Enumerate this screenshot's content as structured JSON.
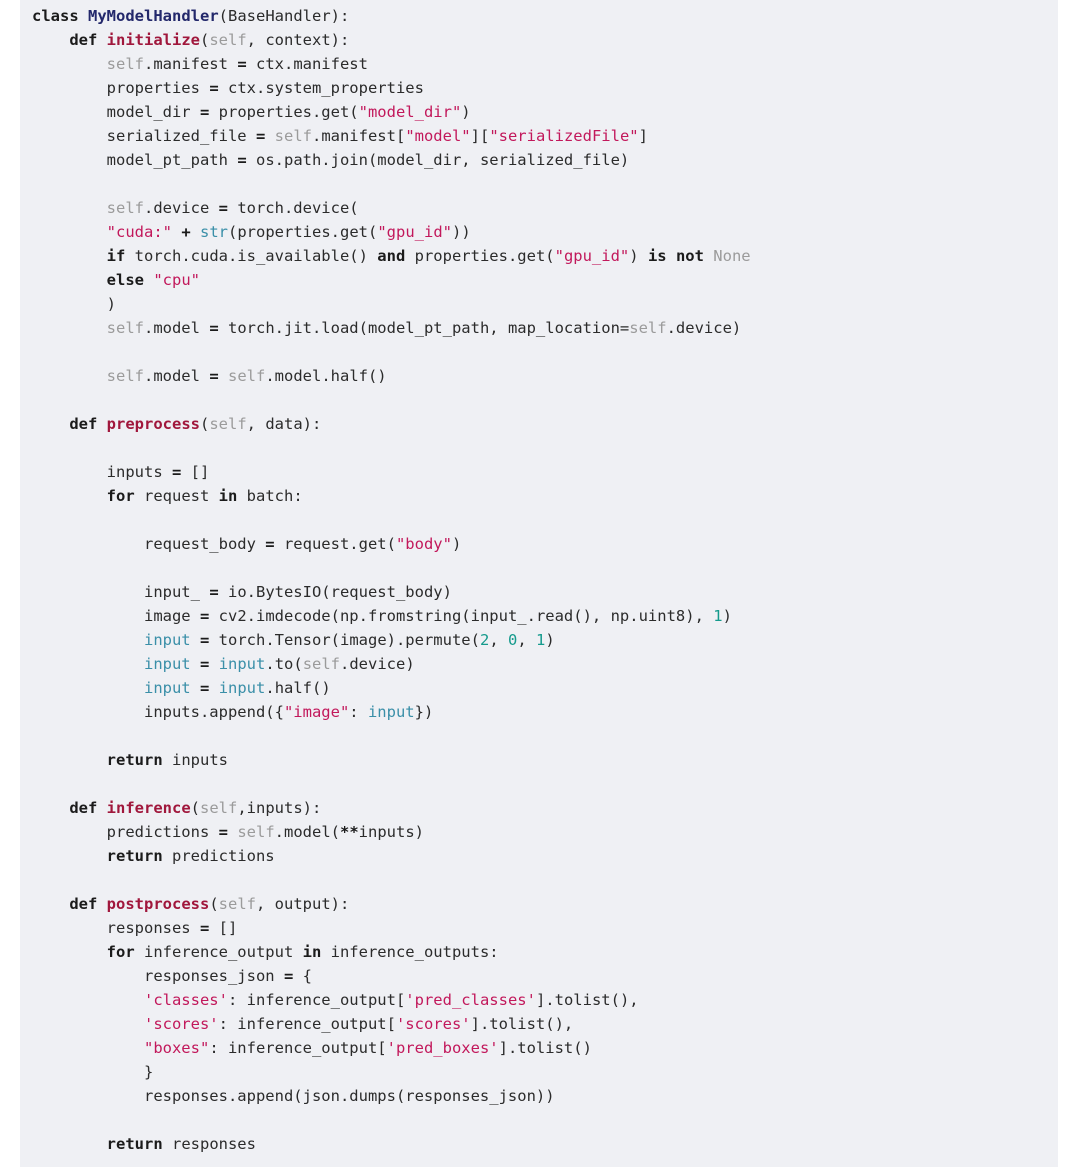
{
  "document": {
    "kind": "code-snippet",
    "language": "python",
    "background_color": "#eff0f4",
    "page_background_color": "#ffffff"
  },
  "theme": {
    "plain": "#2b2b2b",
    "keyword": "#1b1b1b",
    "class_name": "#23286b",
    "function_name": "#a0173c",
    "string": "#c2185b",
    "number": "#149a8c",
    "builtin": "#3a8fa8",
    "self": "#9b9b9b",
    "none": "#9b9b9b"
  },
  "code": {
    "lines": [
      [
        {
          "t": "kw",
          "v": "class"
        },
        {
          "t": "plain",
          "v": " "
        },
        {
          "t": "class",
          "v": "MyModelHandler"
        },
        {
          "t": "plain",
          "v": "(BaseHandler):"
        }
      ],
      [
        {
          "t": "plain",
          "v": "    "
        },
        {
          "t": "def",
          "v": "def"
        },
        {
          "t": "plain",
          "v": " "
        },
        {
          "t": "func",
          "v": "initialize"
        },
        {
          "t": "plain",
          "v": "("
        },
        {
          "t": "self",
          "v": "self"
        },
        {
          "t": "plain",
          "v": ", context):"
        }
      ],
      [
        {
          "t": "plain",
          "v": "        "
        },
        {
          "t": "self",
          "v": "self"
        },
        {
          "t": "plain",
          "v": ".manifest "
        },
        {
          "t": "op-b",
          "v": "="
        },
        {
          "t": "plain",
          "v": " ctx.manifest"
        }
      ],
      [
        {
          "t": "plain",
          "v": "        properties "
        },
        {
          "t": "op-b",
          "v": "="
        },
        {
          "t": "plain",
          "v": " ctx.system_properties"
        }
      ],
      [
        {
          "t": "plain",
          "v": "        model_dir "
        },
        {
          "t": "op-b",
          "v": "="
        },
        {
          "t": "plain",
          "v": " properties.get("
        },
        {
          "t": "str",
          "v": "\"model_dir\""
        },
        {
          "t": "plain",
          "v": ")"
        }
      ],
      [
        {
          "t": "plain",
          "v": "        serialized_file "
        },
        {
          "t": "op-b",
          "v": "="
        },
        {
          "t": "plain",
          "v": " "
        },
        {
          "t": "self",
          "v": "self"
        },
        {
          "t": "plain",
          "v": ".manifest["
        },
        {
          "t": "str",
          "v": "\"model\""
        },
        {
          "t": "plain",
          "v": "]["
        },
        {
          "t": "str",
          "v": "\"serializedFile\""
        },
        {
          "t": "plain",
          "v": "]"
        }
      ],
      [
        {
          "t": "plain",
          "v": "        model_pt_path "
        },
        {
          "t": "op-b",
          "v": "="
        },
        {
          "t": "plain",
          "v": " os.path.join(model_dir, serialized_file)"
        }
      ],
      [],
      [
        {
          "t": "plain",
          "v": "        "
        },
        {
          "t": "self",
          "v": "self"
        },
        {
          "t": "plain",
          "v": ".device "
        },
        {
          "t": "op-b",
          "v": "="
        },
        {
          "t": "plain",
          "v": " torch.device("
        }
      ],
      [
        {
          "t": "plain",
          "v": "        "
        },
        {
          "t": "str",
          "v": "\"cuda:\""
        },
        {
          "t": "plain",
          "v": " "
        },
        {
          "t": "op-b",
          "v": "+"
        },
        {
          "t": "plain",
          "v": " "
        },
        {
          "t": "builtin",
          "v": "str"
        },
        {
          "t": "plain",
          "v": "(properties.get("
        },
        {
          "t": "str",
          "v": "\"gpu_id\""
        },
        {
          "t": "plain",
          "v": "))"
        }
      ],
      [
        {
          "t": "plain",
          "v": "        "
        },
        {
          "t": "kw",
          "v": "if"
        },
        {
          "t": "plain",
          "v": " torch.cuda.is_available() "
        },
        {
          "t": "kw",
          "v": "and"
        },
        {
          "t": "plain",
          "v": " properties.get("
        },
        {
          "t": "str",
          "v": "\"gpu_id\""
        },
        {
          "t": "plain",
          "v": ") "
        },
        {
          "t": "kw",
          "v": "is"
        },
        {
          "t": "plain",
          "v": " "
        },
        {
          "t": "kw",
          "v": "not"
        },
        {
          "t": "plain",
          "v": " "
        },
        {
          "t": "none",
          "v": "None"
        }
      ],
      [
        {
          "t": "plain",
          "v": "        "
        },
        {
          "t": "kw",
          "v": "else"
        },
        {
          "t": "plain",
          "v": " "
        },
        {
          "t": "str",
          "v": "\"cpu\""
        }
      ],
      [
        {
          "t": "plain",
          "v": "        )"
        }
      ],
      [
        {
          "t": "plain",
          "v": "        "
        },
        {
          "t": "self",
          "v": "self"
        },
        {
          "t": "plain",
          "v": ".model "
        },
        {
          "t": "op-b",
          "v": "="
        },
        {
          "t": "plain",
          "v": " torch.jit.load(model_pt_path, map_location="
        },
        {
          "t": "self",
          "v": "self"
        },
        {
          "t": "plain",
          "v": ".device)"
        }
      ],
      [],
      [
        {
          "t": "plain",
          "v": "        "
        },
        {
          "t": "self",
          "v": "self"
        },
        {
          "t": "plain",
          "v": ".model "
        },
        {
          "t": "op-b",
          "v": "="
        },
        {
          "t": "plain",
          "v": " "
        },
        {
          "t": "self",
          "v": "self"
        },
        {
          "t": "plain",
          "v": ".model.half()"
        }
      ],
      [],
      [
        {
          "t": "plain",
          "v": "    "
        },
        {
          "t": "def",
          "v": "def"
        },
        {
          "t": "plain",
          "v": " "
        },
        {
          "t": "func",
          "v": "preprocess"
        },
        {
          "t": "plain",
          "v": "("
        },
        {
          "t": "self",
          "v": "self"
        },
        {
          "t": "plain",
          "v": ", data):"
        }
      ],
      [],
      [
        {
          "t": "plain",
          "v": "        inputs "
        },
        {
          "t": "op-b",
          "v": "="
        },
        {
          "t": "plain",
          "v": " []"
        }
      ],
      [
        {
          "t": "plain",
          "v": "        "
        },
        {
          "t": "kw",
          "v": "for"
        },
        {
          "t": "plain",
          "v": " request "
        },
        {
          "t": "kw",
          "v": "in"
        },
        {
          "t": "plain",
          "v": " batch:"
        }
      ],
      [],
      [
        {
          "t": "plain",
          "v": "            request_body "
        },
        {
          "t": "op-b",
          "v": "="
        },
        {
          "t": "plain",
          "v": " request.get("
        },
        {
          "t": "str",
          "v": "\"body\""
        },
        {
          "t": "plain",
          "v": ")"
        }
      ],
      [],
      [
        {
          "t": "plain",
          "v": "            input_ "
        },
        {
          "t": "op-b",
          "v": "="
        },
        {
          "t": "plain",
          "v": " io.BytesIO(request_body)"
        }
      ],
      [
        {
          "t": "plain",
          "v": "            image "
        },
        {
          "t": "op-b",
          "v": "="
        },
        {
          "t": "plain",
          "v": " cv2.imdecode(np.fromstring(input_.read(), np.uint8), "
        },
        {
          "t": "num",
          "v": "1"
        },
        {
          "t": "plain",
          "v": ")"
        }
      ],
      [
        {
          "t": "plain",
          "v": "            "
        },
        {
          "t": "builtin",
          "v": "input"
        },
        {
          "t": "plain",
          "v": " "
        },
        {
          "t": "op-b",
          "v": "="
        },
        {
          "t": "plain",
          "v": " torch.Tensor(image).permute("
        },
        {
          "t": "num",
          "v": "2"
        },
        {
          "t": "plain",
          "v": ", "
        },
        {
          "t": "num",
          "v": "0"
        },
        {
          "t": "plain",
          "v": ", "
        },
        {
          "t": "num",
          "v": "1"
        },
        {
          "t": "plain",
          "v": ")"
        }
      ],
      [
        {
          "t": "plain",
          "v": "            "
        },
        {
          "t": "builtin",
          "v": "input"
        },
        {
          "t": "plain",
          "v": " "
        },
        {
          "t": "op-b",
          "v": "="
        },
        {
          "t": "plain",
          "v": " "
        },
        {
          "t": "builtin",
          "v": "input"
        },
        {
          "t": "plain",
          "v": ".to("
        },
        {
          "t": "self",
          "v": "self"
        },
        {
          "t": "plain",
          "v": ".device)"
        }
      ],
      [
        {
          "t": "plain",
          "v": "            "
        },
        {
          "t": "builtin",
          "v": "input"
        },
        {
          "t": "plain",
          "v": " "
        },
        {
          "t": "op-b",
          "v": "="
        },
        {
          "t": "plain",
          "v": " "
        },
        {
          "t": "builtin",
          "v": "input"
        },
        {
          "t": "plain",
          "v": ".half()"
        }
      ],
      [
        {
          "t": "plain",
          "v": "            inputs.append({"
        },
        {
          "t": "str",
          "v": "\"image\""
        },
        {
          "t": "plain",
          "v": ": "
        },
        {
          "t": "builtin",
          "v": "input"
        },
        {
          "t": "plain",
          "v": "})"
        }
      ],
      [],
      [
        {
          "t": "plain",
          "v": "        "
        },
        {
          "t": "kw",
          "v": "return"
        },
        {
          "t": "plain",
          "v": " inputs"
        }
      ],
      [],
      [
        {
          "t": "plain",
          "v": "    "
        },
        {
          "t": "def",
          "v": "def"
        },
        {
          "t": "plain",
          "v": " "
        },
        {
          "t": "func",
          "v": "inference"
        },
        {
          "t": "plain",
          "v": "("
        },
        {
          "t": "self",
          "v": "self"
        },
        {
          "t": "plain",
          "v": ",inputs):"
        }
      ],
      [
        {
          "t": "plain",
          "v": "        predictions "
        },
        {
          "t": "op-b",
          "v": "="
        },
        {
          "t": "plain",
          "v": " "
        },
        {
          "t": "self",
          "v": "self"
        },
        {
          "t": "plain",
          "v": ".model("
        },
        {
          "t": "op-b",
          "v": "**"
        },
        {
          "t": "plain",
          "v": "inputs)"
        }
      ],
      [
        {
          "t": "plain",
          "v": "        "
        },
        {
          "t": "kw",
          "v": "return"
        },
        {
          "t": "plain",
          "v": " predictions"
        }
      ],
      [],
      [
        {
          "t": "plain",
          "v": "    "
        },
        {
          "t": "def",
          "v": "def"
        },
        {
          "t": "plain",
          "v": " "
        },
        {
          "t": "func",
          "v": "postprocess"
        },
        {
          "t": "plain",
          "v": "("
        },
        {
          "t": "self",
          "v": "self"
        },
        {
          "t": "plain",
          "v": ", output):"
        }
      ],
      [
        {
          "t": "plain",
          "v": "        responses "
        },
        {
          "t": "op-b",
          "v": "="
        },
        {
          "t": "plain",
          "v": " []"
        }
      ],
      [
        {
          "t": "plain",
          "v": "        "
        },
        {
          "t": "kw",
          "v": "for"
        },
        {
          "t": "plain",
          "v": " inference_output "
        },
        {
          "t": "kw",
          "v": "in"
        },
        {
          "t": "plain",
          "v": " inference_outputs:"
        }
      ],
      [
        {
          "t": "plain",
          "v": "            responses_json "
        },
        {
          "t": "op-b",
          "v": "="
        },
        {
          "t": "plain",
          "v": " {"
        }
      ],
      [
        {
          "t": "plain",
          "v": "            "
        },
        {
          "t": "str",
          "v": "'classes'"
        },
        {
          "t": "plain",
          "v": ": inference_output["
        },
        {
          "t": "str",
          "v": "'pred_classes'"
        },
        {
          "t": "plain",
          "v": "].tolist(),"
        }
      ],
      [
        {
          "t": "plain",
          "v": "            "
        },
        {
          "t": "str",
          "v": "'scores'"
        },
        {
          "t": "plain",
          "v": ": inference_output["
        },
        {
          "t": "str",
          "v": "'scores'"
        },
        {
          "t": "plain",
          "v": "].tolist(),"
        }
      ],
      [
        {
          "t": "plain",
          "v": "            "
        },
        {
          "t": "str",
          "v": "\"boxes\""
        },
        {
          "t": "plain",
          "v": ": inference_output["
        },
        {
          "t": "str",
          "v": "'pred_boxes'"
        },
        {
          "t": "plain",
          "v": "].tolist()"
        }
      ],
      [
        {
          "t": "plain",
          "v": "            }"
        }
      ],
      [
        {
          "t": "plain",
          "v": "            responses.append(json.dumps(responses_json))"
        }
      ],
      [],
      [
        {
          "t": "plain",
          "v": "        "
        },
        {
          "t": "kw",
          "v": "return"
        },
        {
          "t": "plain",
          "v": " responses"
        }
      ]
    ]
  }
}
